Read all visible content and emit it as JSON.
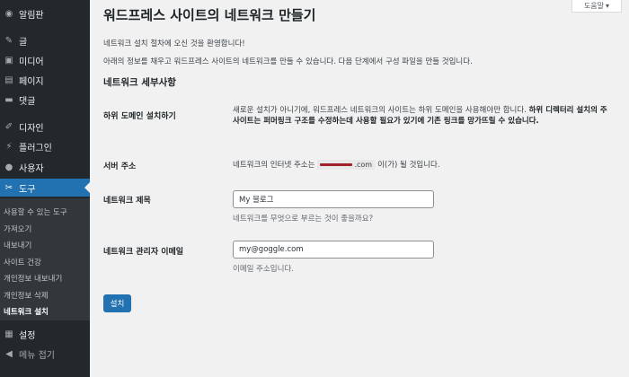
{
  "help_tab": {
    "label": "도움말",
    "arrow": "▾"
  },
  "sidebar": {
    "items": [
      {
        "label": "알림판",
        "icon": "dashboard-icon",
        "glyph": "◉"
      },
      {
        "label": "글",
        "icon": "pin-icon",
        "glyph": "✎"
      },
      {
        "label": "미디어",
        "icon": "media-icon",
        "glyph": "▣"
      },
      {
        "label": "페이지",
        "icon": "page-icon",
        "glyph": "▤"
      },
      {
        "label": "댓글",
        "icon": "comment-icon",
        "glyph": "▬"
      },
      {
        "label": "디자인",
        "icon": "appearance-icon",
        "glyph": "✐"
      },
      {
        "label": "플러그인",
        "icon": "plugin-icon",
        "glyph": "⚡"
      },
      {
        "label": "사용자",
        "icon": "user-icon",
        "glyph": "●"
      },
      {
        "label": "도구",
        "icon": "wrench-icon",
        "glyph": "✂"
      },
      {
        "label": "설정",
        "icon": "settings-icon",
        "glyph": "▦"
      },
      {
        "label": "메뉴 접기",
        "icon": "collapse-icon",
        "glyph": "◀"
      }
    ],
    "submenu": [
      "사용할 수 있는 도구",
      "가져오기",
      "내보내기",
      "사이트 건강",
      "개인정보 내보내기",
      "개인정보 삭제",
      "네트워크 설치"
    ]
  },
  "main": {
    "title": "워드프레스 사이트의 네트워크 만들기",
    "welcome": "네트워크 설치 절차에 오신 것을 환영합니다!",
    "instructions": "아래의 정보를 채우고 워드프레스 사이트의 네트워크를 만들 수 있습니다. 다음 단계에서 구성 파일을 만들 것입니다.",
    "section_title": "네트워크 세부사항",
    "subdomain": {
      "label": "하위 도메인 설치하기",
      "desc_plain": "새로운 설치가 아니기에, 워드프레스 네트워크의 사이트는 하위 도메인을 사용해야만 합니다.",
      "desc_bold": "하위 디렉터리 설치의 주 사이트는 퍼머링크 구조를 수정하는데 사용할 필요가 있기에 기존 링크를 망가뜨릴 수 있습니다."
    },
    "server": {
      "label": "서버 주소",
      "prefix": "네트워크의 인터넷 주소는",
      "domain_suffix": ".com",
      "suffix": "이(가) 될 것입니다."
    },
    "network_title": {
      "label": "네트워크 제목",
      "value": "My 블로그",
      "hint": "네트워크를 무엇으로 부르는 것이 좋을까요?"
    },
    "admin_email": {
      "label": "네트워크 관리자 이메일",
      "value": "my@goggle.com",
      "hint": "이메일 주소입니다."
    },
    "install_button": "설치"
  },
  "colors": {
    "sidebar": "#23282d",
    "accent": "#2271b1",
    "background": "#f1f1f1"
  }
}
